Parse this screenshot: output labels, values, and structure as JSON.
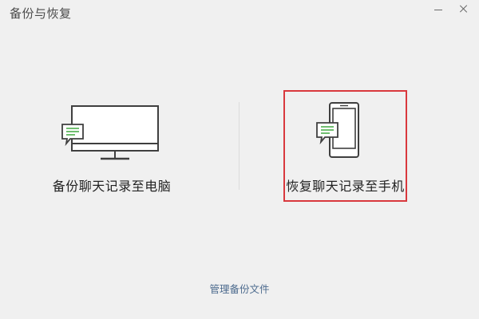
{
  "window": {
    "title": "备份与恢复"
  },
  "options": {
    "backup_to_pc": {
      "label": "备份聊天记录至电脑",
      "icon": "pc-monitor-chat-icon"
    },
    "restore_to_phone": {
      "label": "恢复聊天记录至手机",
      "icon": "phone-chat-icon",
      "highlighted": true,
      "highlight_color": "#d9383d"
    }
  },
  "footer": {
    "manage_label": "管理备份文件"
  },
  "colors": {
    "background": "#f0f0f0",
    "icon_stroke": "#3f3f3f",
    "chat_green": "#4cae4c",
    "link": "#4d6b8e"
  }
}
